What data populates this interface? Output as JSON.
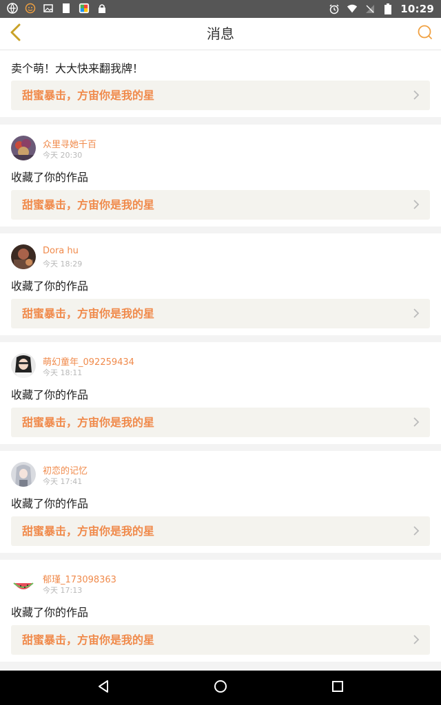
{
  "status_bar": {
    "time": "10:29",
    "left_icons": [
      "browser-icon",
      "emoji-icon",
      "image-icon",
      "white-card-icon",
      "colorful-app-icon",
      "lock-icon"
    ],
    "right_icons": [
      "alarm-icon",
      "wifi-icon",
      "no-signal-icon",
      "battery-icon"
    ]
  },
  "app_bar": {
    "title": "消息",
    "back_icon": "chevron-left-icon",
    "search_icon": "search-icon"
  },
  "feed": {
    "partial_item": {
      "message": "卖个萌！大大快来翻我牌！",
      "work_title": "甜蜜暴击，方宙你是我的星"
    },
    "items": [
      {
        "name": "众里寻她千百",
        "time": "今天 20:30",
        "message": "收藏了你的作品",
        "work_title": "甜蜜暴击，方宙你是我的星"
      },
      {
        "name": "Dora hu",
        "time": "今天 18:29",
        "message": "收藏了你的作品",
        "work_title": "甜蜜暴击，方宙你是我的星"
      },
      {
        "name": "萌幻童年_092259434",
        "time": "今天 18:11",
        "message": "收藏了你的作品",
        "work_title": "甜蜜暴击，方宙你是我的星"
      },
      {
        "name": "初恋的记忆",
        "time": "今天 17:41",
        "message": "收藏了你的作品",
        "work_title": "甜蜜暴击，方宙你是我的星"
      },
      {
        "name": "郁瑾_173098363",
        "time": "今天 17:13",
        "message": "收藏了你的作品",
        "work_title": "甜蜜暴击，方宙你是我的星"
      }
    ]
  },
  "colors": {
    "accent": "#f08a4b",
    "back_arrow": "#c9a227",
    "link_bg": "#f4f3ee",
    "status_bar_bg": "#565656",
    "nav_bar_bg": "#000000"
  },
  "nav_bar": {
    "icons": [
      "back-triangle-icon",
      "home-circle-icon",
      "recents-square-icon"
    ]
  }
}
